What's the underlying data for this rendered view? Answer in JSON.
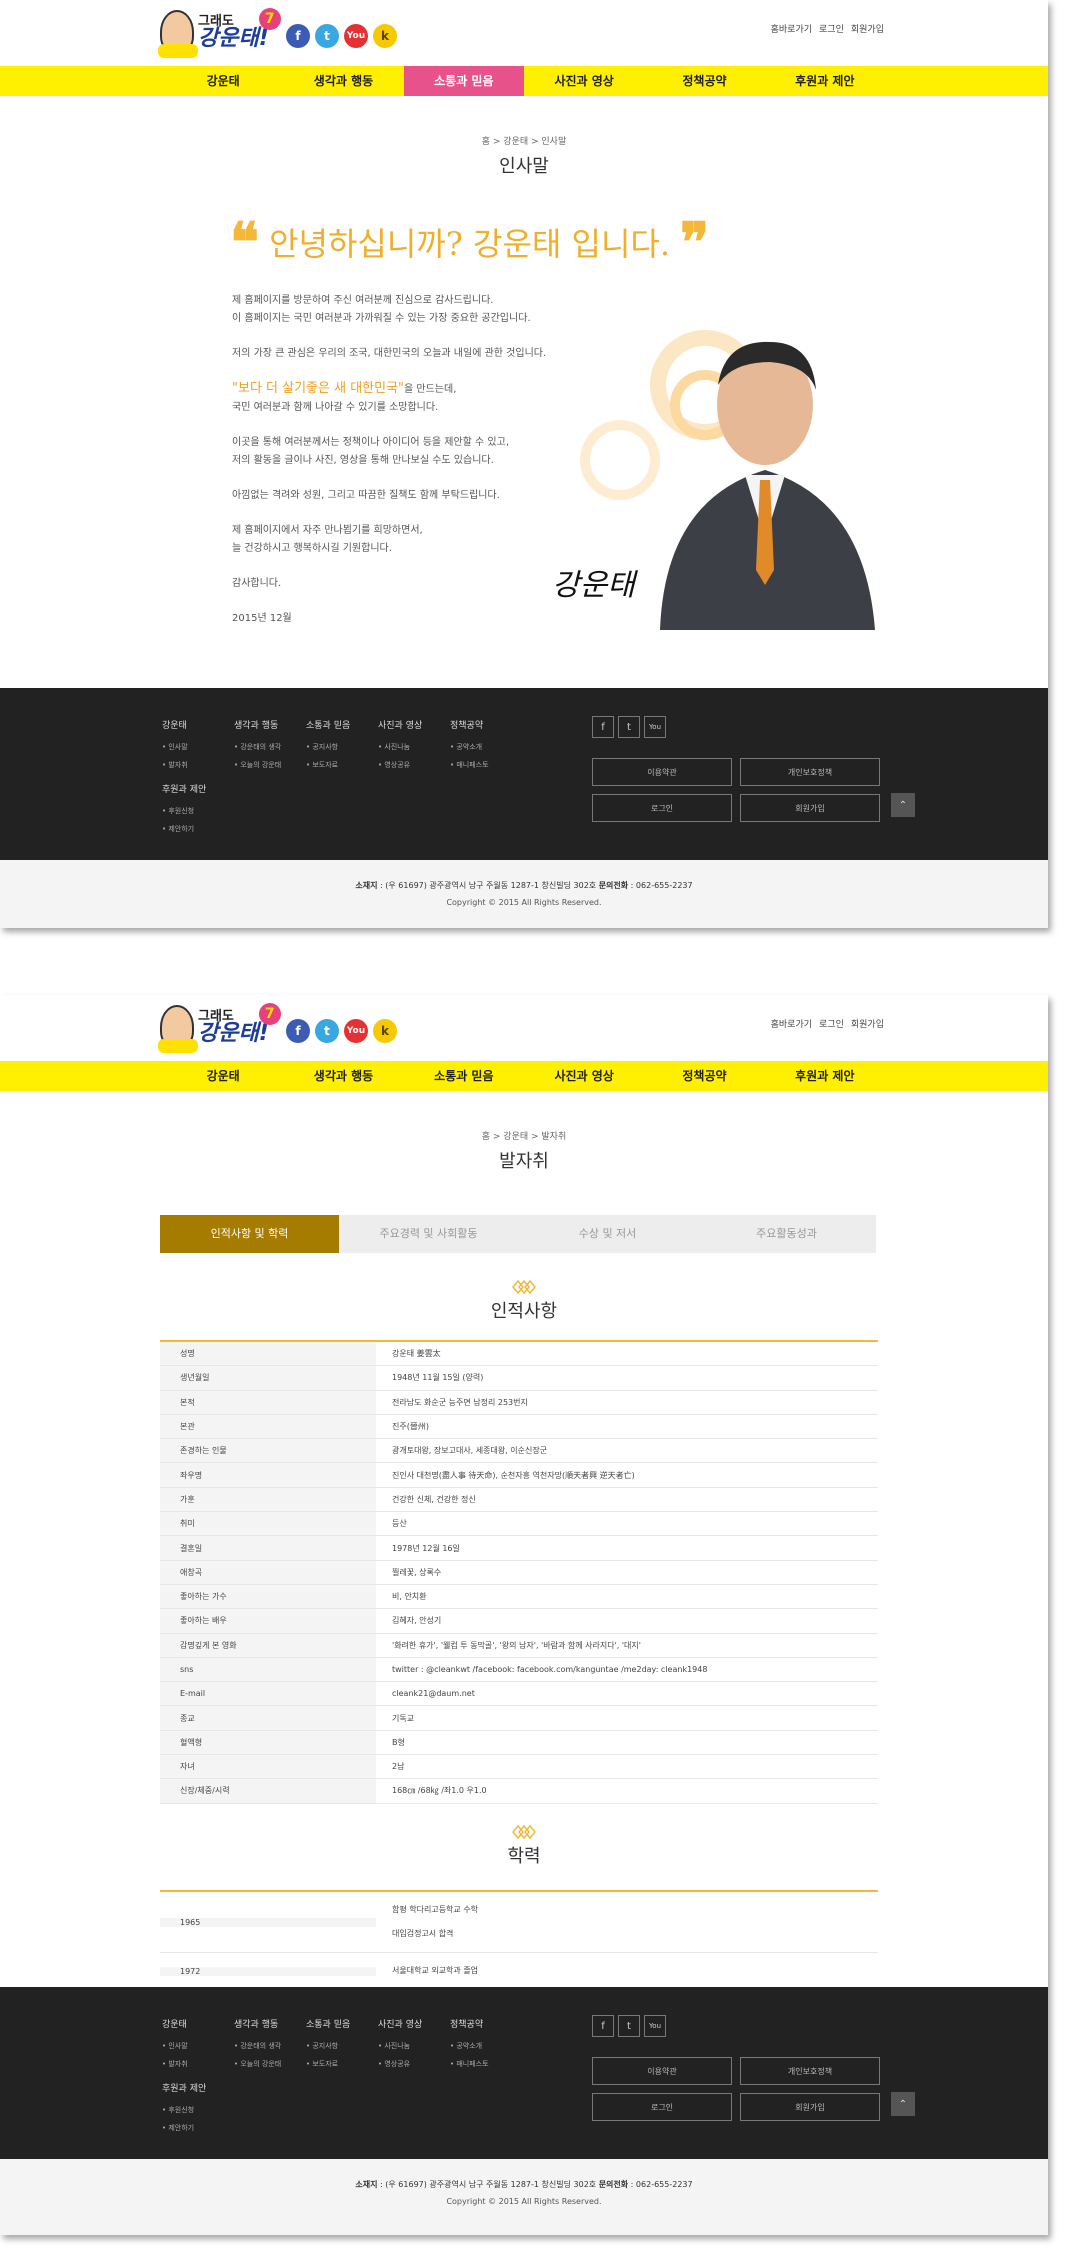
{
  "header": {
    "logo_top": "그래도",
    "logo_main": "강운태!",
    "logo_number": "7",
    "sns": [
      {
        "icon": "facebook-icon",
        "glyph": "f"
      },
      {
        "icon": "twitter-icon",
        "glyph": "t"
      },
      {
        "icon": "youtube-icon",
        "glyph": "You"
      },
      {
        "icon": "kakao-icon",
        "glyph": "k"
      }
    ],
    "util": [
      "홈바로가기",
      "로그인",
      "회원가입"
    ]
  },
  "nav": [
    "강운태",
    "생각과 행동",
    "소통과 믿음",
    "사진과 영상",
    "정책공약",
    "후원과 제안"
  ],
  "page1": {
    "active_nav": 2,
    "breadcrumb": "홈 > 강운태 > 인사말",
    "title": "인사말",
    "quote": "안녕하십니까? 강운태 입니다.",
    "greeting": {
      "p1a": "제 홈페이지를 방문하여 주신 여러분께 진심으로 감사드립니다.",
      "p1b": "이 홈페이지는 국민 여러분과 가까워질 수 있는 가장 중요한 공간입니다.",
      "p2": "저의 가장 큰 관심은 우리의 조국, 대한민국의 오늘과 내일에 관한 것입니다.",
      "p3_highlight": "\"보다 더 살기좋은 새 대한민국\"",
      "p3a": "을 만드는데,",
      "p3b": "국민 여러분과 함께 나아갈 수 있기를 소망합니다.",
      "p4a": "이곳을 통해 여러분께서는 정책이나 아이디어 등을 제안할 수 있고,",
      "p4b": "저의 활동을 글이나 사진, 영상을 통해 만나보실 수도 있습니다.",
      "p5": "아낌없는 격려와 성원, 그리고 따끔한 질책도 함께 부탁드립니다.",
      "p6a": "제 홈페이지에서 자주 만나뵙기를 희망하면서,",
      "p6b": "늘 건강하시고 행복하시길 기원합니다.",
      "p7": "감사합니다.",
      "date": "2015년 12월"
    },
    "signature": "강운태"
  },
  "page2": {
    "active_nav": -1,
    "breadcrumb": "홈 > 강운태 > 발자취",
    "title": "발자취",
    "tabs": [
      "인적사항 및 학력",
      "주요경력 및 사회활동",
      "수상 및 저서",
      "주요활동성과"
    ],
    "active_tab": 0,
    "personal_title": "인적사항",
    "personal": [
      [
        "성명",
        "강운태 姜雲太"
      ],
      [
        "생년월일",
        "1948년 11월 15일 (양력)"
      ],
      [
        "본적",
        "전라남도 화순군 능주면 남정리 253번지"
      ],
      [
        "본관",
        "진주(晉州)"
      ],
      [
        "존경하는 인물",
        "광개토대왕, 장보고대사, 세종대왕, 이순신장군"
      ],
      [
        "좌우명",
        "진인사 대천명(盡人事 待天命), 순천자흥 역천자망(順天者興 逆天者亡)"
      ],
      [
        "가훈",
        "건강한 신체, 건강한 정신"
      ],
      [
        "취미",
        "등산"
      ],
      [
        "결혼일",
        "1978년 12월 16일"
      ],
      [
        "애창곡",
        "찔레꽃, 상록수"
      ],
      [
        "좋아하는 가수",
        "비, 안치환"
      ],
      [
        "좋아하는 배우",
        "김혜자, 안성기"
      ],
      [
        "감명깊게 본 영화",
        "'화려한 휴가', '웰컴 투 동막골', '왕의 남자', '바람과 함께 사라지다', '대지'"
      ],
      [
        "sns",
        "twitter : @cleankwt /facebook: facebook.com/kanguntae /me2day: cleank1948"
      ],
      [
        "E-mail",
        "cleank21@daum.net"
      ],
      [
        "종교",
        "기독교"
      ],
      [
        "혈액형",
        "B형"
      ],
      [
        "자녀",
        "2남"
      ],
      [
        "신장/체중/시력",
        "168㎝ /68㎏ /좌1.0 우1.0"
      ]
    ],
    "edu_title": "학력",
    "education": [
      {
        "year": "1965",
        "lines": [
          "함평 학다리고등학교 수학",
          "대입검정고시 합격"
        ]
      },
      {
        "year": "1972",
        "lines": [
          "서울대학교 외교학과 졸업"
        ]
      }
    ]
  },
  "footer": {
    "cols": [
      {
        "head": "강운태",
        "items": [
          "• 인사말",
          "• 발자취"
        ]
      },
      {
        "head": "생각과 행동",
        "items": [
          "• 강운태의 생각",
          "• 오늘의 강운태"
        ]
      },
      {
        "head": "소통과 믿음",
        "items": [
          "• 공지사항",
          "• 보도자료"
        ]
      },
      {
        "head": "사진과 영상",
        "items": [
          "• 사진나눔",
          "• 영상공유"
        ]
      },
      {
        "head": "정책공약",
        "items": [
          "• 공약소개",
          "• 매니페스토"
        ]
      },
      {
        "head": "후원과 제안",
        "items": [
          "• 후원신청",
          "• 제안하기"
        ]
      }
    ],
    "sns": [
      "f",
      "t",
      "You"
    ],
    "buttons": [
      "이용약관",
      "개인보호정책",
      "로그인",
      "회원가입"
    ],
    "top": "⌃",
    "address_label": "소재지",
    "address": " : (우 61697) 광주광역시 남구 주월동 1287-1 창신빌딩 302호 ",
    "phone_label": "문의전화",
    "phone": " : 062-655-2237",
    "copyright": "Copyright © 2015 All Rights Reserved."
  }
}
